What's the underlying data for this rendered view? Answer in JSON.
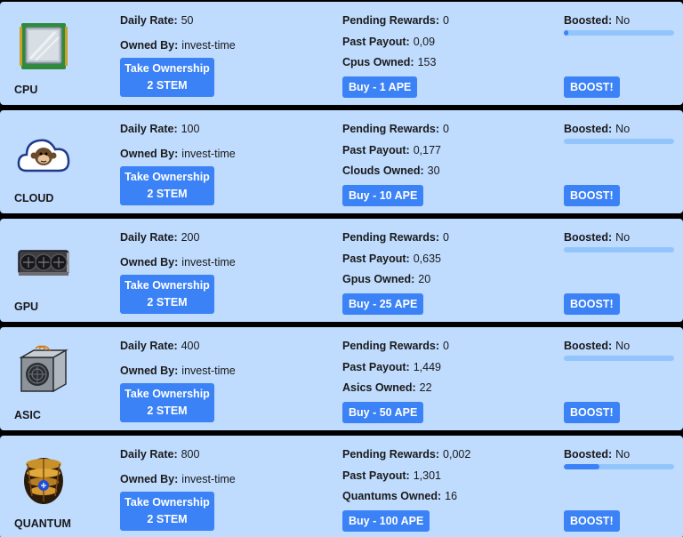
{
  "labels": {
    "daily_rate": "Daily Rate:",
    "owned_by": "Owned By:",
    "pending_rewards": "Pending Rewards:",
    "past_payout": "Past Payout:",
    "boosted": "Boosted:",
    "take_ownership": "Take Ownership",
    "boost_button": "BOOST!"
  },
  "colors": {
    "card_bg": "#bfdbfe",
    "button": "#3b82f6",
    "progress_track": "#93c5fd",
    "page_bg": "#000000"
  },
  "items": [
    {
      "name": "CPU",
      "icon": "cpu-chip-icon",
      "daily_rate": "50",
      "owned_by": "invest-time",
      "take_cost": "2 STEM",
      "pending_rewards": "0",
      "past_payout": "0,09",
      "owned_label": "Cpus Owned:",
      "owned_count": "153",
      "buy_label": "Buy - 1 APE",
      "boosted": "No",
      "boost_progress": 0.04
    },
    {
      "name": "CLOUD",
      "icon": "cloud-monkey-icon",
      "daily_rate": "100",
      "owned_by": "invest-time",
      "take_cost": "2 STEM",
      "pending_rewards": "0",
      "past_payout": "0,177",
      "owned_label": "Clouds Owned:",
      "owned_count": "30",
      "buy_label": "Buy - 10 APE",
      "boosted": "No",
      "boost_progress": 0
    },
    {
      "name": "GPU",
      "icon": "gpu-card-icon",
      "daily_rate": "200",
      "owned_by": "invest-time",
      "take_cost": "2 STEM",
      "pending_rewards": "0",
      "past_payout": "0,635",
      "owned_label": "Gpus Owned:",
      "owned_count": "20",
      "buy_label": "Buy - 25 APE",
      "boosted": "No",
      "boost_progress": 0
    },
    {
      "name": "ASIC",
      "icon": "asic-miner-icon",
      "daily_rate": "400",
      "owned_by": "invest-time",
      "take_cost": "2 STEM",
      "pending_rewards": "0",
      "past_payout": "1,449",
      "owned_label": "Asics Owned:",
      "owned_count": "22",
      "buy_label": "Buy - 50 APE",
      "boosted": "No",
      "boost_progress": 0
    },
    {
      "name": "QUANTUM",
      "icon": "quantum-computer-icon",
      "daily_rate": "800",
      "owned_by": "invest-time",
      "take_cost": "2 STEM",
      "pending_rewards": "0,002",
      "past_payout": "1,301",
      "owned_label": "Quantums Owned:",
      "owned_count": "16",
      "buy_label": "Buy - 100 APE",
      "boosted": "No",
      "boost_progress": 0.32
    }
  ]
}
